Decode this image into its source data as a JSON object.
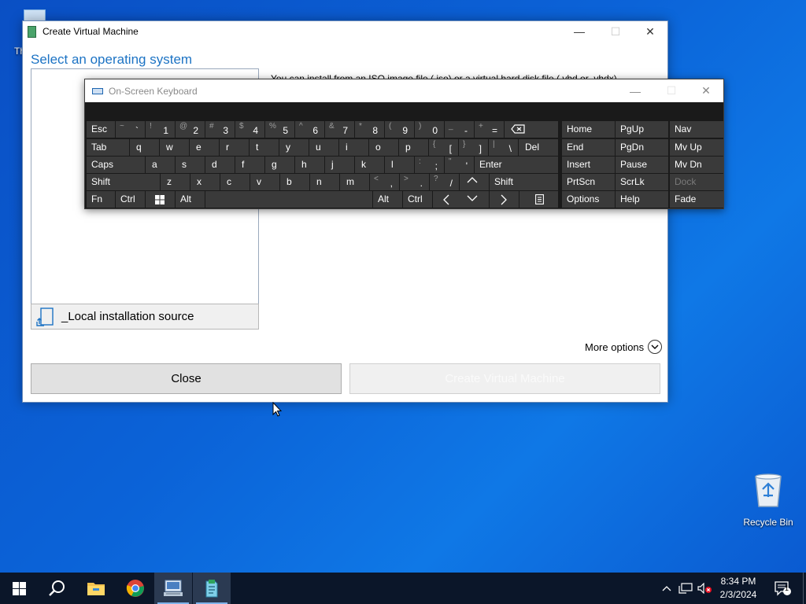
{
  "desktop": {
    "partial_icon_label": "Th",
    "recycle_bin_label": "Recycle Bin"
  },
  "dialog": {
    "title": "Create Virtual Machine",
    "section_title": "Select an operating system",
    "local_source_label": "_Local installation source",
    "info_text": "You can install from an ISO image file (.iso) or a virtual hard disk file (.vhd or .vhdx).",
    "more_options_label": "More options",
    "close_button_label": "Close",
    "create_button_label": "Create Virtual Machine",
    "minimize_glyph": "—",
    "maximize_glyph": "☐",
    "close_glyph": "✕"
  },
  "osk": {
    "title": "On-Screen Keyboard",
    "minimize_glyph": "—",
    "maximize_glyph": "☐",
    "close_glyph": "✕",
    "keys": {
      "esc": "Esc",
      "tilde_sh": "~",
      "tilde": "`",
      "k1_sh": "!",
      "k1": "1",
      "k2_sh": "@",
      "k2": "2",
      "k3_sh": "#",
      "k3": "3",
      "k4_sh": "$",
      "k4": "4",
      "k5_sh": "%",
      "k5": "5",
      "k6_sh": "^",
      "k6": "6",
      "k7_sh": "&",
      "k7": "7",
      "k8_sh": "*",
      "k8": "8",
      "k9_sh": "(",
      "k9": "9",
      "k0_sh": ")",
      "k0": "0",
      "minus_sh": "_",
      "minus": "-",
      "equals_sh": "+",
      "equals": "=",
      "tab": "Tab",
      "q": "q",
      "w": "w",
      "e": "e",
      "r": "r",
      "t": "t",
      "y": "y",
      "u": "u",
      "i": "i",
      "o": "o",
      "p": "p",
      "lbr_sh": "{",
      "lbr": "[",
      "rbr_sh": "}",
      "rbr": "]",
      "bsl_sh": "|",
      "bsl": "\\",
      "del": "Del",
      "caps": "Caps",
      "a": "a",
      "s": "s",
      "d": "d",
      "f": "f",
      "g": "g",
      "h": "h",
      "j": "j",
      "k": "k",
      "l": "l",
      "semi_sh": ":",
      "semi": ";",
      "quote_sh": "\"",
      "quote": "'",
      "enter": "Enter",
      "shift": "Shift",
      "z": "z",
      "x": "x",
      "c": "c",
      "v": "v",
      "b": "b",
      "n": "n",
      "m": "m",
      "comma_sh": "<",
      "comma": ",",
      "period_sh": ">",
      "period": ".",
      "slash_sh": "?",
      "slash": "/",
      "fn": "Fn",
      "ctrl": "Ctrl",
      "alt": "Alt",
      "home": "Home",
      "pgup": "PgUp",
      "nav": "Nav",
      "end": "End",
      "pgdn": "PgDn",
      "mvup": "Mv Up",
      "insert": "Insert",
      "pause": "Pause",
      "mvdn": "Mv Dn",
      "prtscn": "PrtScn",
      "scrlk": "ScrLk",
      "dock": "Dock",
      "options": "Options",
      "help": "Help",
      "fade": "Fade"
    }
  },
  "taskbar": {
    "time": "8:34 PM",
    "date": "2/3/2024",
    "notification_count": "1"
  }
}
